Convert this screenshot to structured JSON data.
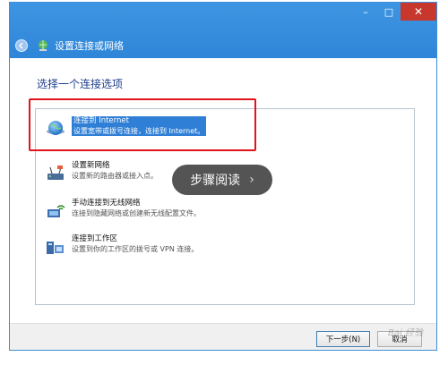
{
  "window": {
    "title": "设置连接或网络",
    "controls": {
      "minimize": "–",
      "maximize": "□",
      "close": "✕"
    }
  },
  "main": {
    "heading": "选择一个连接选项",
    "options": [
      {
        "title": "连接到 Internet",
        "desc": "设置宽带或拨号连接，连接到 Internet。",
        "icon": "globe-icon",
        "selected": true
      },
      {
        "title": "设置新网络",
        "desc": "设置新的路由器或接入点。",
        "icon": "router-icon",
        "selected": false
      },
      {
        "title": "手动连接到无线网络",
        "desc": "连接到隐藏网络或创建新无线配置文件。",
        "icon": "wireless-icon",
        "selected": false
      },
      {
        "title": "连接到工作区",
        "desc": "设置到你的工作区的拨号或 VPN 连接。",
        "icon": "workplace-icon",
        "selected": false
      }
    ]
  },
  "overlay": {
    "label": "步骤阅读",
    "chevron": "›"
  },
  "footer": {
    "next_label": "下一步(N)",
    "cancel_label": "取消"
  },
  "watermark": "Bai 经验",
  "colors": {
    "titlebar": "#2f86d8",
    "selection": "#2f7fd6",
    "highlight": "#e0141a",
    "close": "#c7372c"
  }
}
